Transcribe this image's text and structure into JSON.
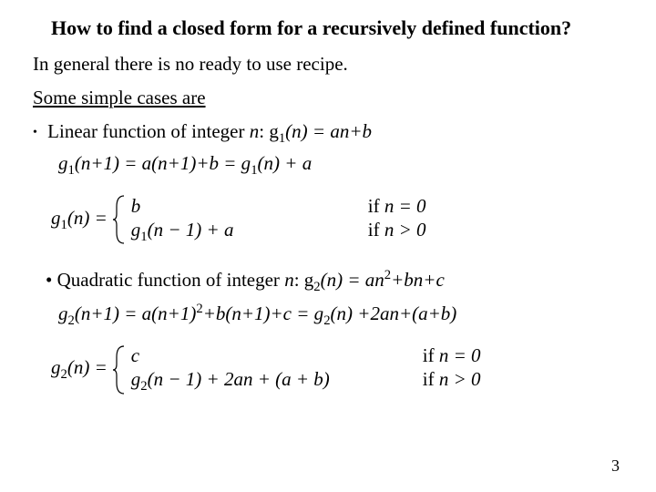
{
  "title": "How to find a closed form for a recursively defined function?",
  "intro": "In general there is no ready to use recipe.",
  "simple_cases_label": "Some simple cases are",
  "linear": {
    "bullet_pre": "Linear function of integer ",
    "var_n": "n",
    "colon_g": ": g",
    "sub1": "1",
    "fn_n": "(n)",
    "eq1_rhs": " = an+b",
    "eq2_lhs_g": "g",
    "eq2_np1": "(n+1)",
    "eq2_mid": " = a(n+1)+b",
    "eq2_rhs": " = g",
    "eq2_tail": "(n) + a",
    "pw_lhs_g": "g",
    "pw_lhs_arg": "(n) = ",
    "case1_expr": "b",
    "case1_cond_pre": "if ",
    "case1_cond": "n = 0",
    "case2_expr_g": "g",
    "case2_expr_arg": "(n − 1) + a",
    "case2_cond_pre": "if ",
    "case2_cond": "n > 0"
  },
  "quadratic": {
    "bullet_pre": "Quadratic function of integer ",
    "var_n": "n",
    "colon_g": ": g",
    "sub2": "2",
    "fn_n": "(n)",
    "eq1_rhs_a": " = an",
    "eq1_rhs_b": "+bn+c",
    "eq2_g": "g",
    "eq2_np1": "(n+1)",
    "eq2_mid_a": " = a(n+1)",
    "eq2_mid_b": "+b(n+1)+c",
    "eq2_rhs_pre": " = g",
    "eq2_rhs_tail": "(n) +2an+(a+b)",
    "pw_lhs_g": "g",
    "pw_lhs_arg": "(n) = ",
    "case1_expr": "c",
    "case1_cond_pre": "if ",
    "case1_cond": "n = 0",
    "case2_expr_g": "g",
    "case2_expr_arg": "(n − 1) + 2an + (a + b)",
    "case2_cond_pre": "if ",
    "case2_cond": "n > 0"
  },
  "page_number": "3"
}
